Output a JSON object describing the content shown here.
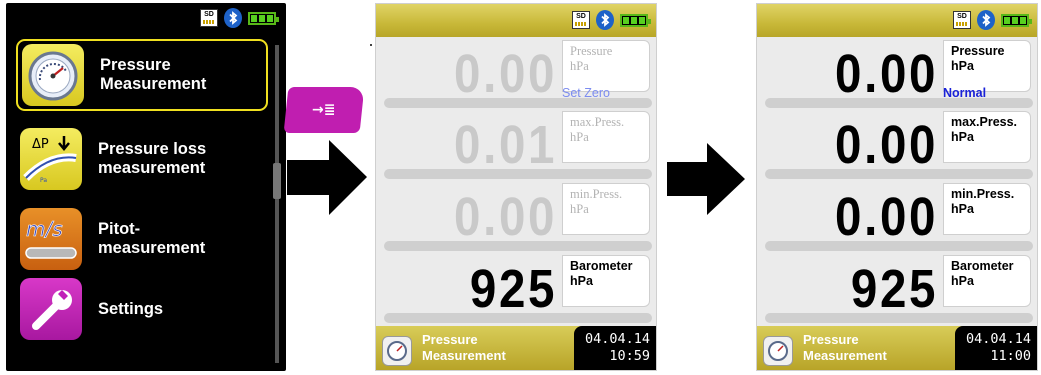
{
  "status_icons": {
    "sd": "SD",
    "bluetooth": "bluetooth-icon",
    "battery": "battery-icon"
  },
  "menu": {
    "items": [
      {
        "label": "Pressure\nMeasurement",
        "icon": "pressure-gauge-icon",
        "selected": true
      },
      {
        "label": "Pressure loss\nmeasurement",
        "icon": "pressure-loss-icon",
        "selected": false
      },
      {
        "label": "Pitot-\nmeasurement",
        "icon": "pitot-icon",
        "selected": false
      },
      {
        "label": "Settings",
        "icon": "wrench-icon",
        "selected": false
      }
    ]
  },
  "enter_key": {
    "symbol": "→≣"
  },
  "screen_zero": {
    "rows": [
      {
        "value": "0.00",
        "name": "Pressure",
        "unit": "hPa"
      },
      {
        "value": "0.01",
        "name": "max.Press.",
        "unit": "hPa"
      },
      {
        "value": "0.00",
        "name": "min.Press.",
        "unit": "hPa"
      },
      {
        "value": "925",
        "name": "Barometer",
        "unit": "hPa"
      }
    ],
    "mode": "Set Zero",
    "footer": {
      "title": "Pressure\nMeasurement",
      "date": "04.04.14",
      "time": "10:59"
    }
  },
  "screen_normal": {
    "rows": [
      {
        "value": "0.00",
        "name": "Pressure",
        "unit": "hPa"
      },
      {
        "value": "0.00",
        "name": "max.Press.",
        "unit": "hPa"
      },
      {
        "value": "0.00",
        "name": "min.Press.",
        "unit": "hPa"
      },
      {
        "value": "925",
        "name": "Barometer",
        "unit": "hPa"
      }
    ],
    "mode": "Normal",
    "footer": {
      "title": "Pressure\nMeasurement",
      "date": "04.04.14",
      "time": "11:00"
    }
  },
  "colors": {
    "accent": "#c8b838",
    "mode_zero": "#7c8cf0",
    "mode_normal": "#1a22d8",
    "menu_highlight": "#f0e020"
  }
}
